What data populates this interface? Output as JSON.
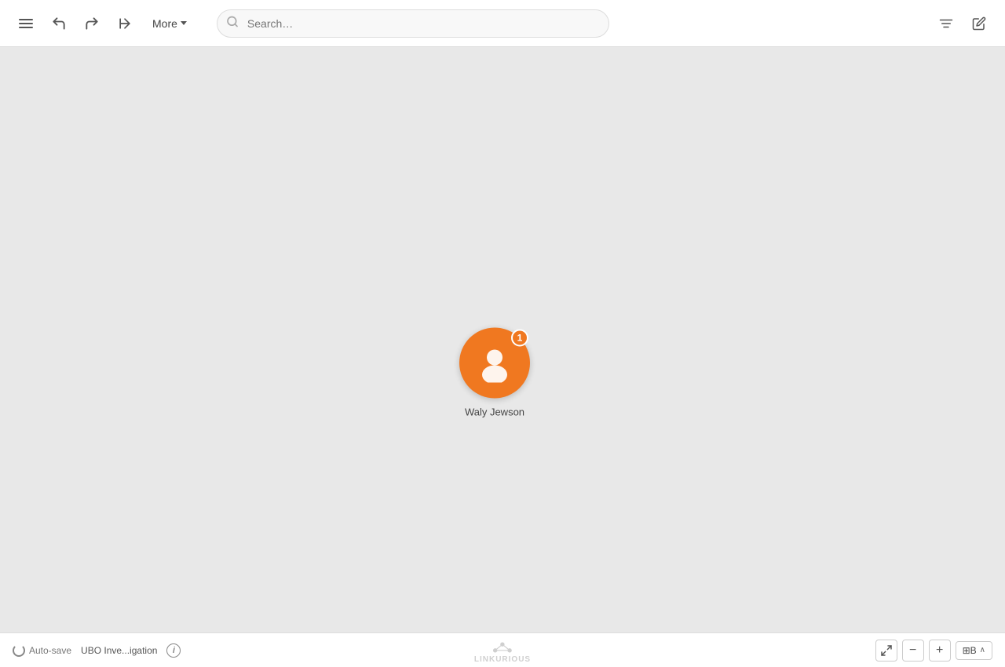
{
  "toolbar": {
    "more_label": "More",
    "undo_title": "Undo",
    "redo_title": "Redo",
    "pin_title": "Pin",
    "chevron_title": "More options dropdown"
  },
  "search": {
    "placeholder": "Search…",
    "value": ""
  },
  "toolbar_right": {
    "filter_title": "Filter",
    "edit_title": "Edit"
  },
  "canvas": {
    "node": {
      "label": "Waly Jewson",
      "badge_count": "1",
      "color": "#f07820"
    }
  },
  "bottom_bar": {
    "autosave_label": "Auto-save",
    "investigation_name": "UBO Inve...igation",
    "info_title": "Info",
    "logo_text": "LINKURIOUS",
    "zoom_in_label": "+",
    "zoom_out_label": "−",
    "fit_label": "⊞B",
    "fit_chevron": "∧"
  }
}
